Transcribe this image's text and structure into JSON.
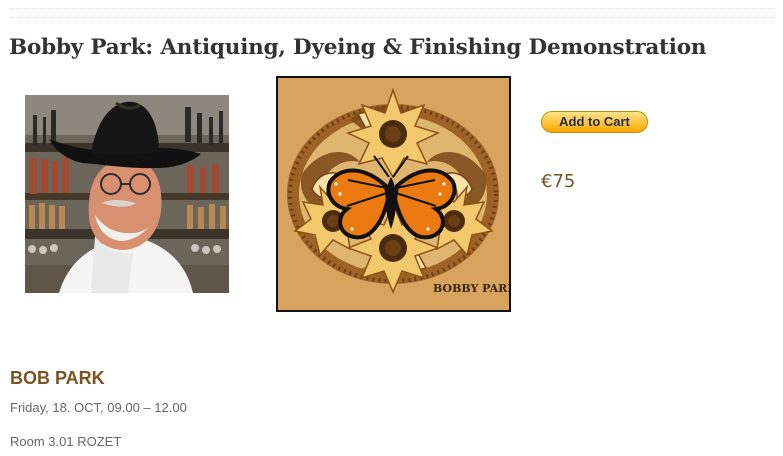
{
  "product": {
    "title": "Bobby Park: Antiquing, Dyeing & Finishing Demonstration",
    "price": "€75",
    "cart_button_label": "Add to Cart",
    "image_signature": "BOBBY PARK"
  },
  "details": {
    "speaker": "BOB PARK",
    "schedule": "Friday, 18. OCT, 09.00 – 12.00",
    "room": "Room 3.01 ROZET"
  },
  "colors": {
    "accent": "#7a5320",
    "cart_button": "#ffc33a",
    "title": "#333333"
  }
}
